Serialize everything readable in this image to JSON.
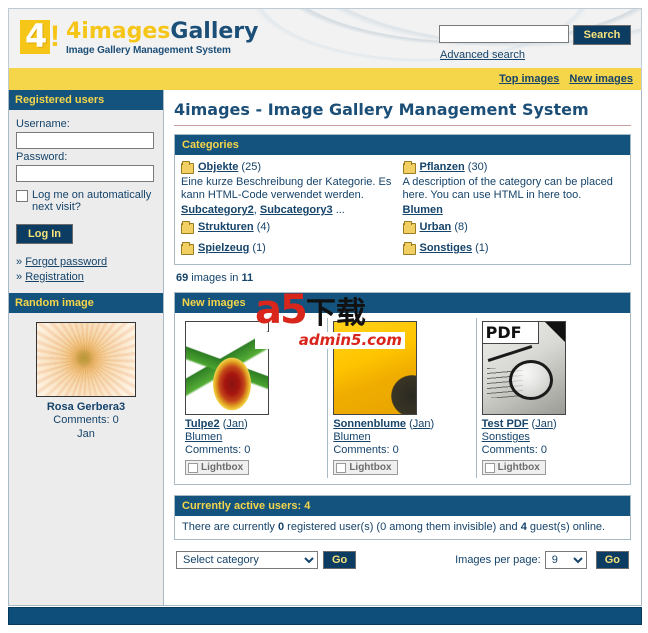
{
  "header": {
    "logo_title_1": "4images",
    "logo_title_2": "Gallery",
    "logo_subtitle": "Image Gallery Management System",
    "logo_mark_digit": "4",
    "logo_mark_bang": "!"
  },
  "search": {
    "value": "",
    "placeholder": "",
    "button_label": "Search",
    "advanced_label": "Advanced search"
  },
  "topnav": {
    "items": [
      {
        "label": "Top images"
      },
      {
        "label": "New images"
      }
    ]
  },
  "sidebar": {
    "login_panel": {
      "title": "Registered users",
      "username_label": "Username:",
      "username_value": "",
      "password_label": "Password:",
      "password_value": "",
      "remember_label": "Log me on automatically next visit?",
      "login_button": "Log In",
      "links": [
        {
          "bullet": "»",
          "label": "Forgot password"
        },
        {
          "bullet": "»",
          "label": "Registration"
        }
      ]
    },
    "random_panel": {
      "title": "Random image",
      "image_title": "Rosa Gerbera3",
      "comments": "Comments: 0",
      "author": "Jan"
    }
  },
  "main": {
    "page_title": "4images - Image Gallery Management System",
    "categories_panel": {
      "title": "Categories",
      "columns": [
        {
          "entries": [
            {
              "name": "Objekte",
              "count": "(25)",
              "description": "Eine kurze Beschreibung der Kategorie. Es kann HTML-Code verwendet werden.",
              "desc_link": "HTML-Code",
              "subcategories": "Subcategory2, Subcategory3 ...",
              "subs": [
                "Subcategory2",
                "Subcategory3"
              ],
              "subs_suffix": "..."
            },
            {
              "name": "Strukturen",
              "count": "(4)"
            },
            {
              "name": "Spielzeug",
              "count": "(1)"
            }
          ]
        },
        {
          "entries": [
            {
              "name": "Pflanzen",
              "count": "(30)",
              "description": "A description of the category can be placed here. You can use HTML in here too.",
              "subcategories": "Blumen",
              "subs": [
                "Blumen"
              ],
              "subs_suffix": ""
            },
            {
              "name": "Urban",
              "count": "(8)"
            },
            {
              "name": "Sonstiges",
              "count": "(1)"
            }
          ]
        }
      ]
    },
    "stats": {
      "image_count": "69",
      "text_middle": " images in ",
      "category_count": "11"
    },
    "new_images_panel": {
      "title": "New images",
      "items": [
        {
          "title": "Tulpe2",
          "author": "Jan",
          "category": "Blumen",
          "comments": "Comments: 0",
          "lightbox_label": "Lightbox"
        },
        {
          "title": "Sonnenblume",
          "author": "Jan",
          "category": "Blumen",
          "comments": "Comments: 0",
          "lightbox_label": "Lightbox"
        },
        {
          "title": "Test PDF",
          "author": "Jan",
          "category": "Sonstiges",
          "comments": "Comments: 0",
          "lightbox_label": "Lightbox",
          "badge": "PDF"
        }
      ]
    },
    "active_users_panel": {
      "title": "Currently active users: 4",
      "text_1": "There are currently ",
      "registered_count": "0",
      "text_2": " registered user(s) (0 among them invisible) and ",
      "guest_count": "4",
      "text_3": " guest(s) online."
    },
    "footer_controls": {
      "category_select_value": "Select category",
      "category_go_label": "Go",
      "images_per_page_label": "Images per page:",
      "images_per_page_value": "9",
      "images_per_page_go_label": "Go"
    }
  },
  "watermark": {
    "brand": "a5",
    "chinese": "下载",
    "url": "admin5.com"
  },
  "colors": {
    "panel_header_bg": "#14537d",
    "panel_header_text": "#f5d54a",
    "accent_yellow": "#f5d54a",
    "link": "#15436a",
    "button_bg": "#0d3c63",
    "button_text": "#f5e27a",
    "footer_bar": "#0d4e7a"
  }
}
